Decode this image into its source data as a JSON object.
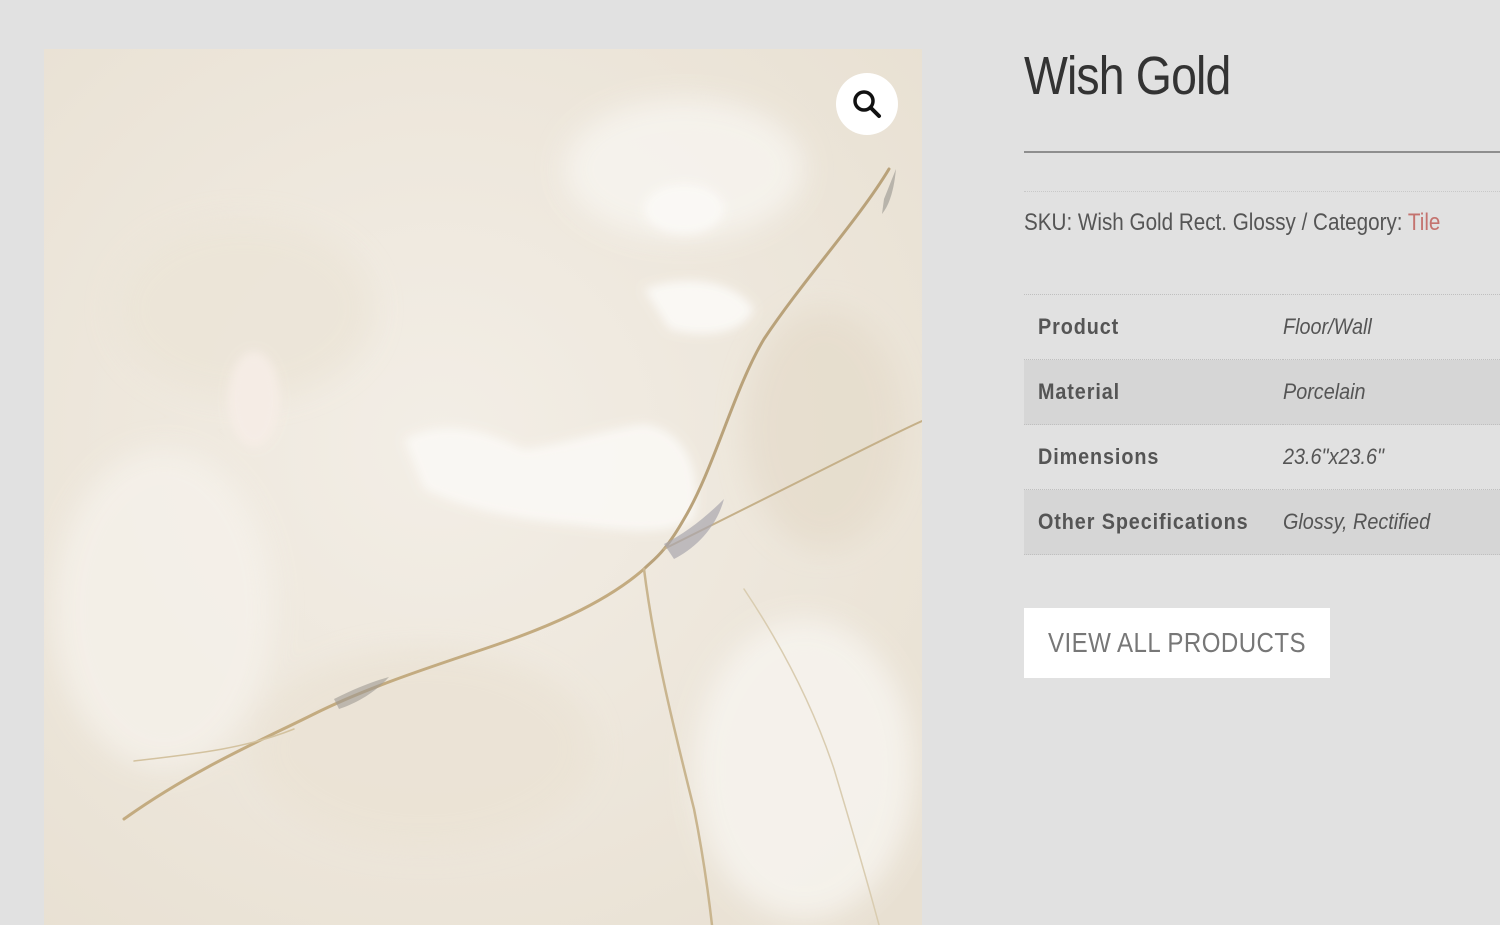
{
  "product": {
    "title": "Wish Gold",
    "sku_label": "SKU:",
    "sku_value": "Wish Gold Rect. Glossy",
    "separator": "/",
    "category_label": "Category:",
    "category_value": "Tile"
  },
  "gallery": {
    "zoom_icon": "magnifier-icon"
  },
  "specs": [
    {
      "label": "Product",
      "value": "Floor/Wall"
    },
    {
      "label": "Material",
      "value": "Porcelain"
    },
    {
      "label": "Dimensions",
      "value": "23.6\"x23.6\""
    },
    {
      "label": "Other Specifications",
      "value": "Glossy, Rectified"
    }
  ],
  "actions": {
    "view_all_label": "VIEW ALL PRODUCTS"
  },
  "colors": {
    "page_background": "#e1e1e1",
    "accent_link": "#c4736f",
    "button_background": "#ffffff"
  }
}
